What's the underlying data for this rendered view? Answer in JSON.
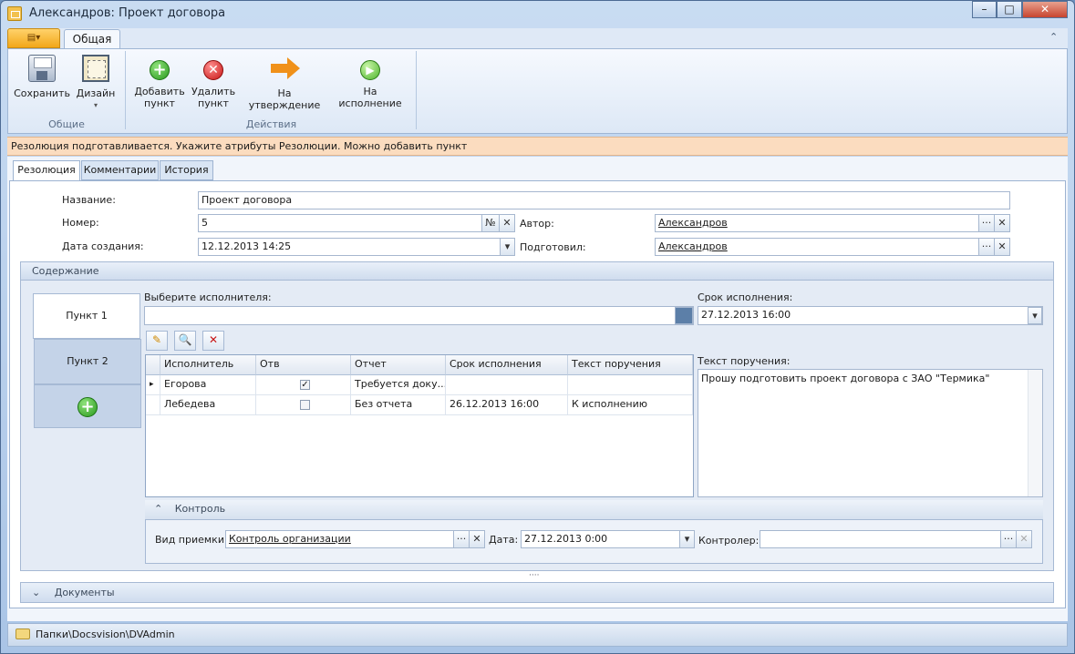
{
  "window": {
    "title": "Александров: Проект договора",
    "minimize": "–",
    "maximize": "□",
    "close": "✕"
  },
  "ribbon": {
    "app_menu_label": "▤▾",
    "tab": "Общая",
    "collapse_symbol": "⌃",
    "groups": {
      "common": "Общие",
      "actions": "Действия"
    },
    "buttons": {
      "save": "Сохранить",
      "design": "Дизайн",
      "design_arrow": "▾",
      "add_item_1": "Добавить",
      "add_item_2": "пункт",
      "delete_item_1": "Удалить",
      "delete_item_2": "пункт",
      "to_approval": "На утверждение",
      "to_execution": "На исполнение"
    }
  },
  "info_message": "Резолюция подготавливается. Укажите атрибуты Резолюции. Можно добавить пункт",
  "form_tabs": [
    "Резолюция",
    "Комментарии",
    "История"
  ],
  "fields": {
    "name_label": "Название:",
    "name_value": "Проект договора",
    "number_label": "Номер:",
    "number_value": "5",
    "number_btn": "№",
    "clear_btn": "✕",
    "created_label": "Дата создания:",
    "created_value": "12.12.2013 14:25",
    "author_label": "Автор:",
    "author_value": "Александров",
    "prepared_label": "Подготовил:",
    "prepared_value": "Александров",
    "ellipsis": "···",
    "dropdown": "▾"
  },
  "content_section": {
    "title": "Содержание",
    "points": [
      "Пункт 1",
      "Пункт 2"
    ],
    "add_point": "+",
    "executor_label": "Выберите исполнителя:",
    "executor_value": "",
    "deadline_label": "Срок исполнения:",
    "deadline_value": "27.12.2013 16:00",
    "task_text_label": "Текст поручения:",
    "task_text_value": "Прошу подготовить проект договора с ЗАО \"Термика\"",
    "toolbar": {
      "edit": "✎",
      "search": "🔍",
      "delete": "✕"
    },
    "grid": {
      "columns": [
        "Исполнитель",
        "Отв",
        "Отчет",
        "Срок исполнения",
        "Текст поручения"
      ],
      "current_row_marker": "▸",
      "rows": [
        {
          "executor": "Егорова",
          "responsible": true,
          "responsible_mark": "✓",
          "report": "Требуется доку...",
          "deadline": "",
          "text": ""
        },
        {
          "executor": "Лебедева",
          "responsible": false,
          "responsible_mark": "",
          "report": "Без отчета",
          "deadline": "26.12.2013 16:00",
          "text": "К исполнению"
        }
      ]
    },
    "control": {
      "title": "Контроль",
      "acceptance_label": "Вид приемки:",
      "acceptance_value": "Контроль организации",
      "date_label": "Дата:",
      "date_value": "27.12.2013 0:00",
      "controller_label": "Контролер:",
      "controller_value": ""
    }
  },
  "splitter": "····",
  "documents_section": {
    "title": "Документы"
  },
  "status_bar": {
    "path": "Папки\\Docsvision\\DVAdmin"
  },
  "chevron_up": "⌃",
  "chevron_down": "⌄",
  "colors": {
    "accent": "#f2a719",
    "info_bg": "#fbdcbf",
    "frame": "#a9c4e6"
  }
}
